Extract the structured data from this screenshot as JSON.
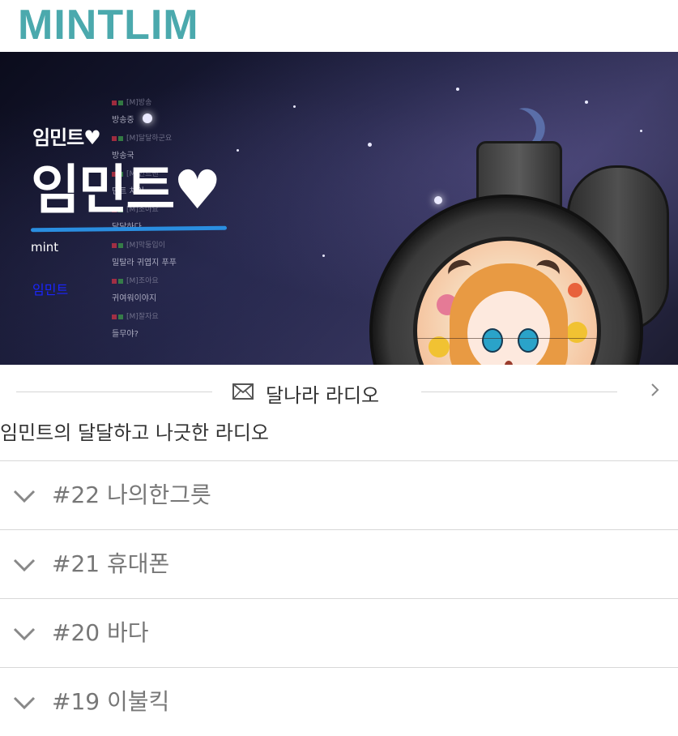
{
  "site": {
    "logo": "MINTLIM",
    "brand_color": "#4ba9ad"
  },
  "banner": {
    "small_title": "임민트♥",
    "big_title": "임민트♥",
    "sub_label": "mint",
    "link_label": "임민트",
    "chat_lines": [
      "[M]방송",
      "방송중",
      "[M]달달하군요",
      "방송국",
      "[M]민트팬",
      "민트 차이",
      "[M]조아요",
      "달달하다",
      "[M]막둥입이",
      "밀탈라 귀엽지 푸푸",
      "[M]조아요",
      "귀여워이야지",
      "[M]잘자요",
      "들무야?"
    ]
  },
  "section": {
    "title": "달나라 라디오",
    "description": "임민트의 달달하고 나긋한 라디오",
    "icon": "mail-icon",
    "nav_icon": "chevron-right-icon"
  },
  "episodes": [
    {
      "title": "#22 나의한그릇"
    },
    {
      "title": "#21 휴대폰"
    },
    {
      "title": "#20 바다"
    },
    {
      "title": "#19 이불킥"
    }
  ]
}
